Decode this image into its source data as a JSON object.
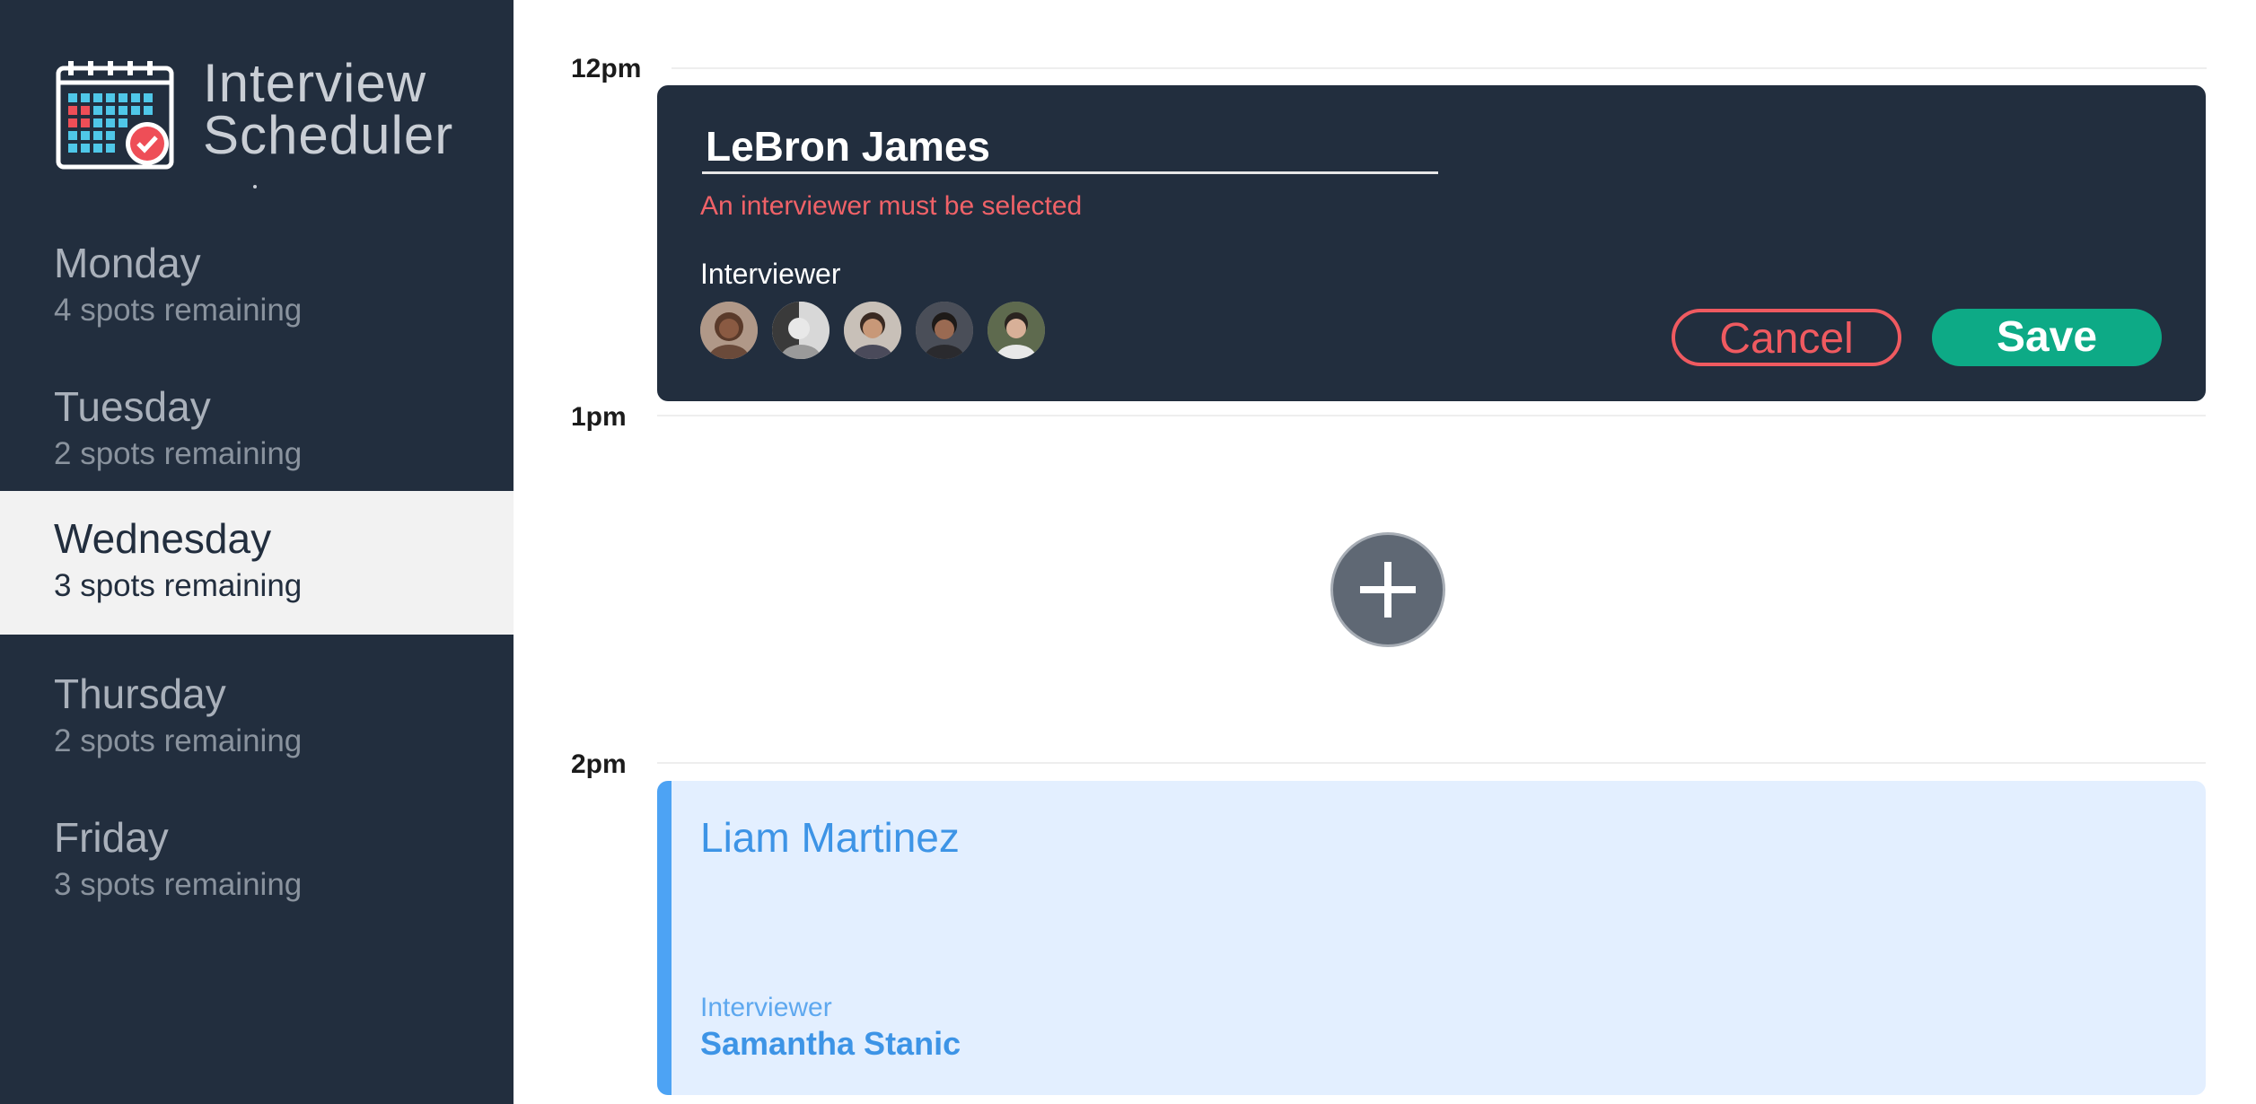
{
  "app": {
    "title_line1": "Interview",
    "title_line2": "Scheduler"
  },
  "sidebar": {
    "days": [
      {
        "name": "Monday",
        "spots": "4 spots remaining",
        "selected": false
      },
      {
        "name": "Tuesday",
        "spots": "2 spots remaining",
        "selected": false
      },
      {
        "name": "Wednesday",
        "spots": "3 spots remaining",
        "selected": true
      },
      {
        "name": "Thursday",
        "spots": "2 spots remaining",
        "selected": false
      },
      {
        "name": "Friday",
        "spots": "3 spots remaining",
        "selected": false
      }
    ]
  },
  "schedule": {
    "times": [
      "12pm",
      "1pm",
      "2pm"
    ],
    "form": {
      "student_name_value": "LeBron James",
      "error": "An interviewer must be selected",
      "interviewer_label": "Interviewer",
      "avatars": [
        "interviewer-avatar-1",
        "interviewer-avatar-2",
        "interviewer-avatar-3",
        "interviewer-avatar-4",
        "interviewer-avatar-5"
      ],
      "cancel_label": "Cancel",
      "save_label": "Save"
    },
    "add_icon": "plus-icon",
    "appointment": {
      "student": "Liam Martinez",
      "interviewer_label": "Interviewer",
      "interviewer_name": "Samantha Stanic"
    }
  },
  "colors": {
    "sidebar_bg": "#222e3e",
    "error": "#f06268",
    "save": "#0daa86",
    "cancel": "#ef5a60",
    "appointment_bg": "#e3efff",
    "appointment_accent": "#4da3f4"
  }
}
